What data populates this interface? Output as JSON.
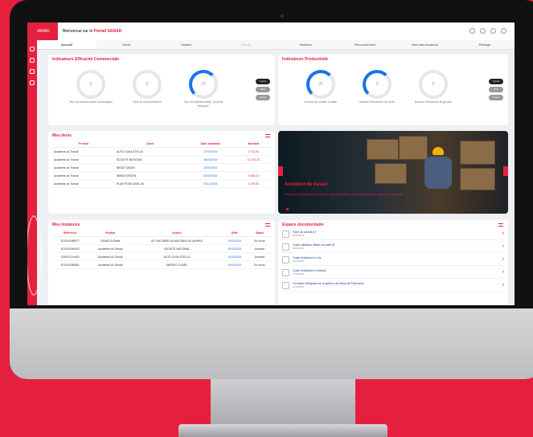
{
  "topbar": {
    "welcome": "Bienvenue sur le ",
    "portal": "Portail SANAD",
    "logo": "SANAD"
  },
  "nav": [
    "Accueil",
    "Devis",
    "Gestion",
    "Clients",
    "Sinistres",
    "Recouvrement",
    "Mes interlocuteurs",
    "Pilotage"
  ],
  "commercial": {
    "title": "Indicateurs Efficacité Commerciale",
    "gauges": [
      {
        "value": "0",
        "label": "Taux de transformation automatique"
      },
      {
        "value": "0",
        "label": "Taux de renouvellement"
      },
      {
        "value": "33",
        "label": "Taux de transformation \"produits délégués\""
      }
    ],
    "pills": [
      "7 jours",
      "Mois",
      "Année"
    ]
  },
  "productivite": {
    "title": "Indicateurs Productivité",
    "gauges": [
      {
        "value": "26",
        "label": "Nombre de sinistre à traiter"
      },
      {
        "value": "2",
        "label": "Nombre d'instances de vente"
      },
      {
        "value": "0",
        "label": "Nombre d'instances de gestion"
      }
    ],
    "pills": [
      "7 jours",
      "Mois",
      "Année"
    ]
  },
  "devis": {
    "title": "Mes devis",
    "headers": [
      "Produit",
      "Client",
      "Date validation",
      "Montant"
    ],
    "rows": [
      [
        "Accidents du Travail",
        "AUTO CASA STELLA",
        "17/04/2019",
        "3.703,93"
      ],
      [
        "Accidents du Travail",
        "SOCIETE NATIONAL",
        "08/04/2019",
        "10.734,78"
      ],
      [
        "Accidents du Travail",
        "INGAZ SAKAN",
        "19/01/2019",
        ""
      ],
      [
        "Accidents du Travail",
        "INMIDI DESIGN",
        "03/01/2019",
        "4.558,13"
      ],
      [
        "Accidents du Travail",
        "PLAN POSE SARL AU",
        "04/12/2018",
        "1.193,92"
      ]
    ]
  },
  "banner": {
    "title": "Accident de travail",
    "text": "Soyez sous assurance dans le cas d'accidents survenus dans le cadre des travaux"
  },
  "instances": {
    "title": "Mes instances",
    "headers": [
      "Référence",
      "Produit",
      "Assuré",
      "Effet",
      "Statut"
    ],
    "rows": [
      [
        "2019/11085577",
        "SANAD Al Brida",
        "AIT HAJ ABDELILHAM SARL AU (AHRAI)",
        "14/02/2019",
        "En cours"
      ],
      [
        "2019/11084002",
        "Accidents du Travail",
        "SOCIETE NATIONAL",
        "30/03/2019",
        "Accordé"
      ],
      [
        "2019/11114490",
        "Accidents du Travail",
        "AUTO CASA STELLA",
        "10/04/2019",
        "Accordé"
      ],
      [
        "2019/11085551",
        "Accidents du Travail",
        "SMFDECO SARL",
        "10/04/2019",
        "En cours"
      ]
    ]
  },
  "docs": {
    "title": "Espace documentaire",
    "items": [
      {
        "name": "Fiche du produit AT",
        "date": "08/04/2019"
      },
      {
        "name": "Guide utilisation affaire nouvelle AT",
        "date": "08/04/2019"
      },
      {
        "name": "Guide d'utilisation e-Vie",
        "date": "01/04/2019"
      },
      {
        "name": "Guide d'utilisation e-Mobilis",
        "date": "27/03/2019"
      },
      {
        "name": "Circulaire Délégation de la gestion des Bons de Pharmacie",
        "date": "01/04/2019"
      }
    ]
  }
}
